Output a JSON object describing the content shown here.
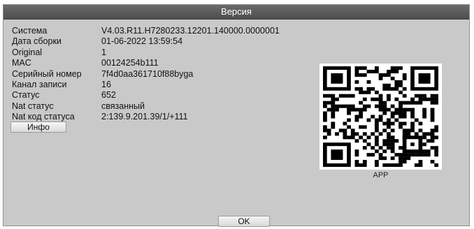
{
  "window": {
    "title": "Версия"
  },
  "info": [
    {
      "label": "Система",
      "value": "V4.03.R11.H7280233.12201.140000.0000001"
    },
    {
      "label": "Дата сборки",
      "value": "01-06-2022 13:59:54"
    },
    {
      "label": "Original",
      "value": "1"
    },
    {
      "label": "MAC",
      "value": "00124254b111"
    },
    {
      "label": "Серийный номер",
      "value": "7f4d0aa361710f88byga"
    },
    {
      "label": "Канал записи",
      "value": "16"
    },
    {
      "label": "Статус",
      "value": "652"
    },
    {
      "label": "Nat статус",
      "value": "связанный"
    },
    {
      "label": "Nat код статуса",
      "value": "2:139.9.201.39/1/+111"
    }
  ],
  "buttons": {
    "info_label": "Инфо",
    "ok_label": "OK"
  },
  "qr": {
    "caption": "APP",
    "icon": "qr-code-icon"
  },
  "colors": {
    "titlebar": "#555555",
    "dialog_bg": "#c9c9c9"
  }
}
